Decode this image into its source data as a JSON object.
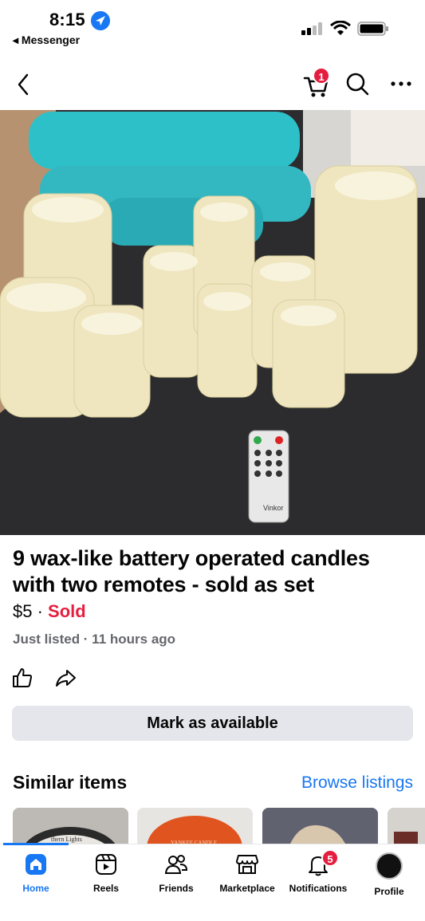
{
  "status_bar": {
    "time": "8:15",
    "back_app": "◂ Messenger"
  },
  "top_nav": {
    "cart_count": "1"
  },
  "listing": {
    "title": "9 wax-like battery operated candles with two remotes - sold as set",
    "price": "$5",
    "separator": " · ",
    "status": "Sold",
    "meta": "Just listed · 11 hours ago",
    "primary_action": "Mark as available",
    "photo_remote_brand": "Vinkor"
  },
  "similar": {
    "title": "Similar items",
    "browse_label": "Browse listings",
    "thumb_texts": [
      "thern Lights",
      "YANKEE CANDLE"
    ]
  },
  "tab_bar": {
    "items": [
      {
        "label": "Home",
        "icon": "home-icon",
        "active": true
      },
      {
        "label": "Reels",
        "icon": "reels-icon"
      },
      {
        "label": "Friends",
        "icon": "friends-icon"
      },
      {
        "label": "Marketplace",
        "icon": "marketplace-icon"
      },
      {
        "label": "Notifications",
        "icon": "bell-icon",
        "badge": "5"
      },
      {
        "label": "Profile",
        "icon": "profile-avatar"
      }
    ]
  },
  "colors": {
    "accent": "#1877f2",
    "sold": "#e41e3f",
    "button_bg": "#e4e6eb"
  }
}
